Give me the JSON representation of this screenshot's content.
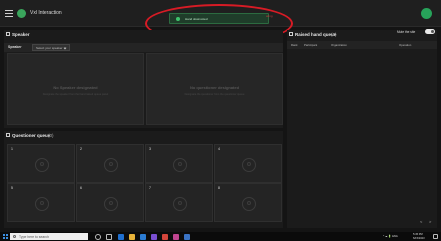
{
  "window": {
    "title": "Vxl Interaction"
  },
  "toast": {
    "message": "Hand downvoted",
    "tail": "ating"
  },
  "speaker_panel": {
    "title": "Speaker",
    "speaker_label": "Speaker",
    "dropdown_value": "Select your speaker",
    "slots": [
      {
        "title": "No Speaker designated",
        "subtitle": "Designate the speaker from the hand raised queue panel"
      },
      {
        "title": "No questioner designated",
        "subtitle": "Designate the questioner from the questioner queue"
      }
    ]
  },
  "queue_panel": {
    "title": "Questioner queue",
    "count": "(0)",
    "slots": [
      "1",
      "2",
      "3",
      "4",
      "5",
      "6",
      "7",
      "8"
    ]
  },
  "hand_panel": {
    "title": "Raised hand queue",
    "count": "(0)",
    "mute_label": "Mute the site",
    "columns": [
      "Rank",
      "Participant",
      "Organization",
      "Operation"
    ],
    "pager": {
      "prev": "<",
      "next": ">"
    }
  },
  "taskbar": {
    "search_placeholder": "Type here to search",
    "time": "5:45 PM",
    "date": "6/15/2023",
    "tray_symbols": "^ ☁ 🔋 ENG"
  },
  "colors": {
    "accent_green": "#3aa55c",
    "annotation_red": "#d81b25"
  },
  "icons": [
    "menu-icon",
    "app-logo-icon",
    "avatar-icon",
    "check-icon",
    "search-icon",
    "windows-icon"
  ]
}
